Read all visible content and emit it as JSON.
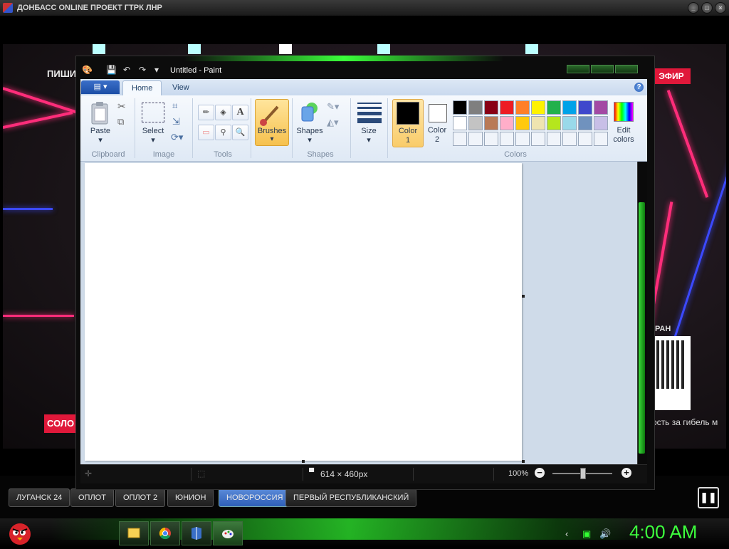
{
  "player": {
    "title": "ДОНБАСС ONLINE ПРОЕКТ ГТРК ЛНР",
    "min": "_",
    "max": "□",
    "close": "×"
  },
  "video": {
    "overlay_top_left": "ПИШИ",
    "overlay_live": "ЭФИР",
    "overlay_bottom_left": "СОЛО",
    "overlay_right_label": "РАН",
    "ticker": "ость за гибель м"
  },
  "channels": [
    {
      "label": "ЛУГАНСК 24",
      "active": false
    },
    {
      "label": "ОПЛОТ",
      "active": false
    },
    {
      "label": "ОПЛОТ 2",
      "active": false
    },
    {
      "label": "ЮНИОН",
      "active": false
    },
    {
      "label": "НОВОРОССИЯ",
      "active": true
    },
    {
      "label": "ПЕРВЫЙ РЕСПУБЛИКАНСКИЙ",
      "active": false
    }
  ],
  "paint": {
    "title": "Untitled - Paint",
    "tabs": [
      "Home",
      "View"
    ],
    "file_tab_icon": "menu-icon",
    "groups": {
      "clipboard": {
        "label": "Clipboard",
        "paste": "Paste"
      },
      "image": {
        "label": "Image",
        "select": "Select"
      },
      "tools": {
        "label": "Tools"
      },
      "brushes": {
        "label": "Brushes"
      },
      "shapes": {
        "label": "Shapes",
        "shapes_btn": "Shapes"
      },
      "size": {
        "label": "Size"
      },
      "colors": {
        "label": "Colors",
        "color1_line1": "Color",
        "color1_line2": "1",
        "color2_line1": "Color",
        "color2_line2": "2",
        "edit_line1": "Edit",
        "edit_line2": "colors"
      }
    },
    "palette_row1": [
      "#000000",
      "#7f7f7f",
      "#880015",
      "#ed1c24",
      "#ff7f27",
      "#fff200",
      "#22b14c",
      "#00a2e8",
      "#3f48cc",
      "#a349a4"
    ],
    "palette_row2": [
      "#ffffff",
      "#c3c3c3",
      "#b97a57",
      "#ffaec9",
      "#ffc90e",
      "#efe4b0",
      "#b5e61d",
      "#99d9ea",
      "#7092be",
      "#c8bfe7"
    ],
    "palette_row3": [
      "#f0f4fa",
      "#f0f4fa",
      "#f0f4fa",
      "#f0f4fa",
      "#f0f4fa",
      "#f0f4fa",
      "#f0f4fa",
      "#f0f4fa",
      "#f0f4fa",
      "#f0f4fa"
    ],
    "color1": "#000000",
    "color2": "#ffffff",
    "status": {
      "dimensions": "614 × 460px",
      "zoom": "100%"
    }
  },
  "taskbar": {
    "clock": "4:00 AM"
  }
}
